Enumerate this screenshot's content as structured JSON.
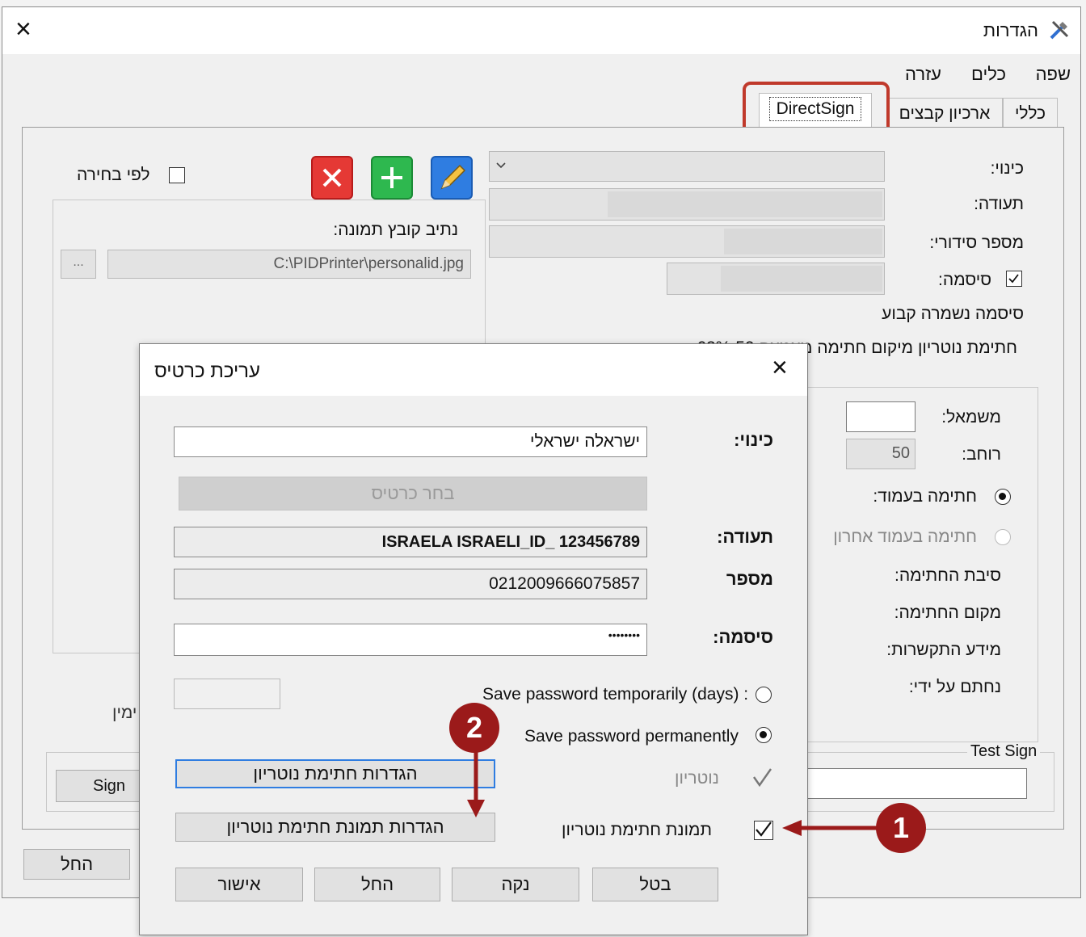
{
  "window": {
    "title": "הגדרות",
    "close": "×"
  },
  "menu": {
    "items": [
      "שפה",
      "כלים",
      "עזרה"
    ]
  },
  "tabs": [
    "כללי",
    "ארכיון קבצים",
    "DirectSign"
  ],
  "left_panel": {
    "by_choice_label": "לפי בחירה",
    "image_path_label": "נתיב קובץ תמונה:",
    "image_path_value": "C:\\PIDPrinter\\personalid.jpg",
    "browse": "...",
    "cut_text": "ימין",
    "sign_button": "Sign",
    "apply_button": "החל"
  },
  "right_panel": {
    "alias_label": "כינוי:",
    "cert_label": "תעודה:",
    "serial_label": "מספר סידורי:",
    "password_label": "סיסמה:",
    "password_saved": "סיסמה נשמרה קבוע",
    "notary_line": "חתימת נוטריון מיקום חתימה מצמצם 50 62%",
    "left_label": "משמאל:",
    "width_label": "רוחב:",
    "width_value": "50",
    "sign_in_page": "חתימה בעמוד:",
    "sign_last_page": "חתימה בעמוד אחרון",
    "sign_reason": "סיבת החתימה:",
    "sign_location": "מקום החתימה:",
    "contact_info": "מידע התקשרות:",
    "signed_by": "נחתם על ידי:",
    "test_sign": "Test Sign"
  },
  "dialog": {
    "title": "עריכת כרטיס",
    "close": "×",
    "alias_label": "כינוי:",
    "alias_value": "ישראלה ישראלי",
    "choose_card": "בחר כרטיס",
    "cert_label": "תעודה:",
    "cert_value": "ISRAELA ISRAELI_ID_  123456789",
    "number_label": "מספר",
    "number_value": "0212009666075857",
    "password_label": "סיסמה:",
    "password_value": "••••••••",
    "save_temp": "Save password temporarily (days) :",
    "save_perm": "Save password permanently",
    "notary_label": "נוטריון",
    "notary_image_label": "תמונת חתימת נוטריון",
    "notary_settings_btn": "הגדרות חתימת נוטריון",
    "notary_image_settings_btn": "הגדרות תמונת חתימת נוטריון",
    "ok": "אישור",
    "apply": "החל",
    "clear": "נקה",
    "cancel": "בטל"
  },
  "callouts": [
    "1",
    "2"
  ],
  "colors": {
    "highlight_red": "#c0392b",
    "callout": "#9b1a1a",
    "delete": "#e53935",
    "add": "#2eb84f",
    "edit": "#2f7de1"
  },
  "icons": [
    "settings-tools-icon",
    "edit-pencil-icon",
    "add-plus-icon",
    "delete-x-icon",
    "dropdown-chevron-icon"
  ]
}
